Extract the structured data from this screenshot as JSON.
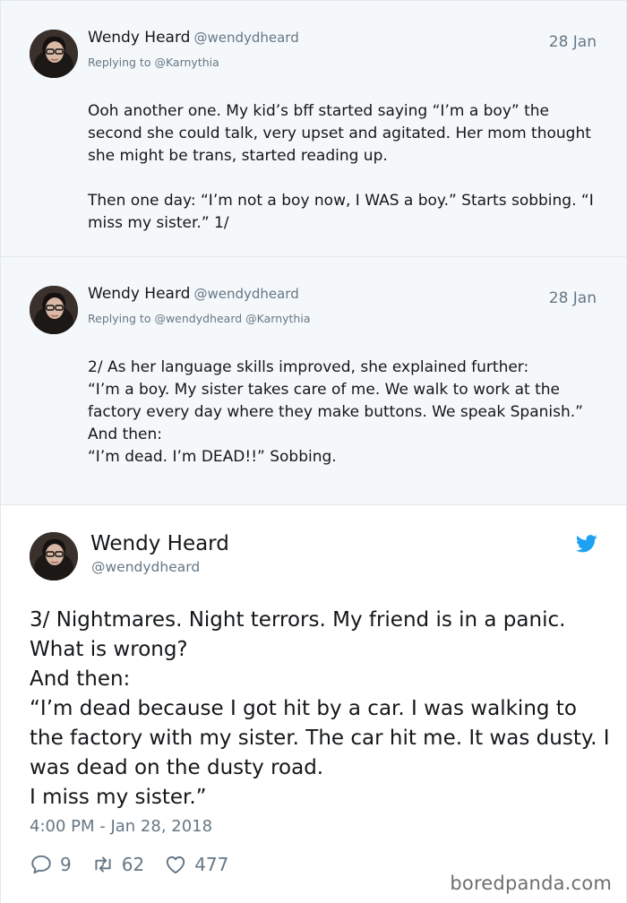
{
  "tweets": [
    {
      "name": "Wendy Heard",
      "handle": "@wendydheard",
      "date": "28 Jan",
      "replying": "Replying to @Karnythia",
      "text": "Ooh another one. My kid’s bff started saying “I’m a boy” the second she could talk, very upset and agitated. Her mom thought she might be trans, started reading up.\n\nThen one day: “I’m not a boy now, I WAS a boy.” Starts sobbing. “I miss my sister.” 1/"
    },
    {
      "name": "Wendy Heard",
      "handle": "@wendydheard",
      "date": "28 Jan",
      "replying": "Replying to @wendydheard @Karnythia",
      "text": "2/ As her language skills improved, she explained further:\n“I’m a boy. My sister takes care of me. We walk to work at the factory every day where they make buttons. We speak Spanish.”\nAnd then:\n“I’m dead. I’m DEAD!!” Sobbing."
    }
  ],
  "main_tweet": {
    "name": "Wendy Heard",
    "handle": "@wendydheard",
    "text": "3/ Nightmares. Night terrors. My friend is in a panic. What is wrong?\nAnd then:\n“I’m dead because I got hit by a car. I was walking to the factory with my sister. The car hit me. It was dusty. I was dead on the dusty road.\nI miss my sister.”",
    "timestamp": "4:00 PM - Jan 28, 2018",
    "replies": "9",
    "retweets": "62",
    "likes": "477",
    "brand_icon": "twitter-bird-icon",
    "brand_color": "#1da1f2"
  },
  "watermark": "boredpanda.com"
}
